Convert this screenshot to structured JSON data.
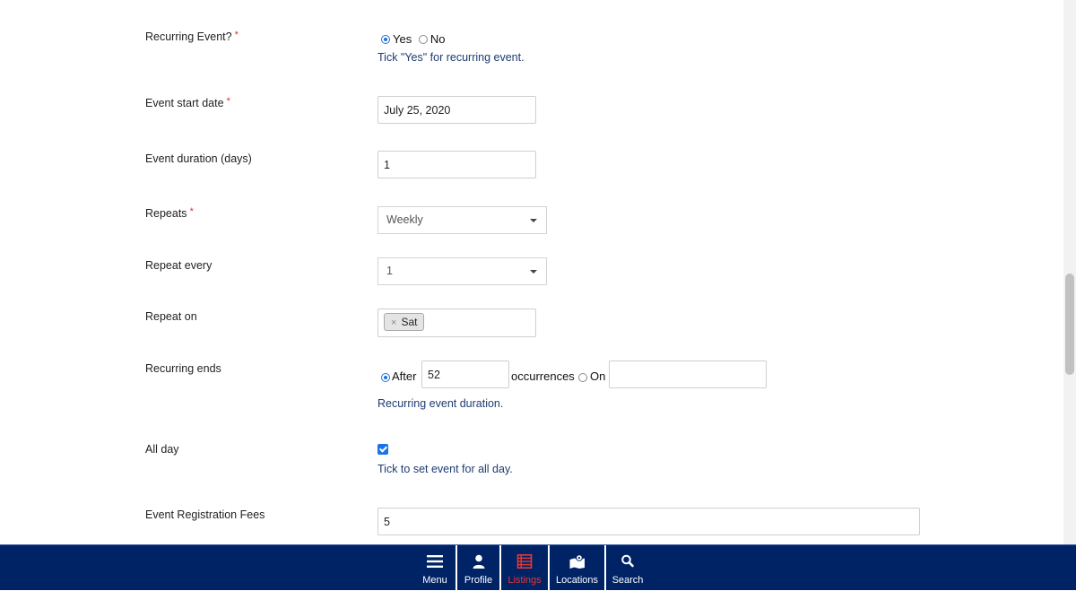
{
  "form": {
    "recurring_event": {
      "label": "Recurring Event?",
      "required": "*",
      "options": [
        "Yes",
        "No"
      ],
      "selected": "Yes",
      "help": "Tick \"Yes\" for recurring event."
    },
    "event_start_date": {
      "label": "Event start date",
      "required": "*",
      "value": "July 25, 2020"
    },
    "event_duration": {
      "label": "Event duration (days)",
      "value": "1"
    },
    "repeats": {
      "label": "Repeats",
      "required": "*",
      "value": "Weekly"
    },
    "repeat_every": {
      "label": "Repeat every",
      "value": "1"
    },
    "repeat_on": {
      "label": "Repeat on",
      "tags": [
        "Sat"
      ],
      "remove_glyph": "×"
    },
    "recurring_ends": {
      "label": "Recurring ends",
      "after_label": "After",
      "after_value": "52",
      "occurrences_label": "occurrences",
      "on_label": "On",
      "on_value": "",
      "selected": "After",
      "help": "Recurring event duration."
    },
    "all_day": {
      "label": "All day",
      "checked": true,
      "help": "Tick to set event for all day."
    },
    "registration_fees": {
      "label": "Event Registration Fees",
      "value": "5"
    }
  },
  "bottom_nav": {
    "items": [
      {
        "label": "Menu",
        "icon": "hamburger-icon",
        "active": false
      },
      {
        "label": "Profile",
        "icon": "user-icon",
        "active": false
      },
      {
        "label": "Listings",
        "icon": "list-icon",
        "active": true
      },
      {
        "label": "Locations",
        "icon": "map-icon",
        "active": false
      },
      {
        "label": "Search",
        "icon": "search-icon",
        "active": false
      }
    ],
    "background": "#002366",
    "active_color": "#e03a3a"
  }
}
